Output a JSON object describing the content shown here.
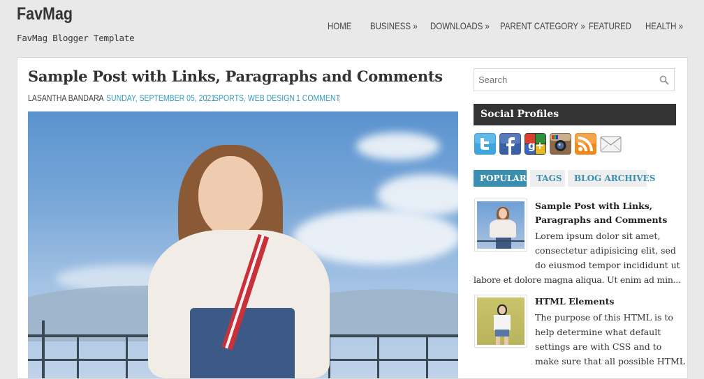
{
  "site": {
    "title": "FavMag",
    "description": "FavMag Blogger Template"
  },
  "nav": [
    {
      "label": "HOME",
      "has_sub": false
    },
    {
      "label": "BUSINESS",
      "has_sub": true
    },
    {
      "label": "DOWNLOADS",
      "has_sub": true
    },
    {
      "label": "PARENT CATEGORY",
      "has_sub": true
    },
    {
      "label": "FEATURED",
      "has_sub": false
    },
    {
      "label": "HEALTH",
      "has_sub": true
    }
  ],
  "nav_arrow": "»",
  "post": {
    "title": "Sample Post with Links, Paragraphs and Comments",
    "author": "LASANTHA BANDARA",
    "date": "SUNDAY, SEPTEMBER 05, 2021",
    "labels": "SPORTS, WEB DESIGN",
    "comments": "1 COMMENT"
  },
  "search": {
    "placeholder": "Search"
  },
  "social_widget": {
    "title": "Social Profiles",
    "icons": [
      "twitter-icon",
      "facebook-icon",
      "google-plus-icon",
      "instagram-icon",
      "rss-icon",
      "email-icon"
    ]
  },
  "tabs": [
    {
      "label": "POPULAR",
      "active": true
    },
    {
      "label": "TAGS",
      "active": false
    },
    {
      "label": "BLOG ARCHIVES",
      "active": false
    }
  ],
  "popular": [
    {
      "title_lines": [
        "Sample Post with Links,",
        "Paragraphs and Comments"
      ],
      "text_lines": [
        "Lorem ipsum dolor sit amet,",
        "consectetur adipisicing elit, sed",
        "do eiusmod tempor incididunt ut",
        "labore et dolore magna aliqua. Ut enim ad min..."
      ]
    },
    {
      "title_lines": [
        "HTML Elements"
      ],
      "text_lines": [
        "The purpose of this HTML is to",
        "help determine what default",
        "settings are with CSS and to",
        "make sure that all possible HTML"
      ]
    }
  ],
  "colors": {
    "accent": "#3a9cc0",
    "tab_active": "#3a8fb0",
    "widget_header": "#333333",
    "background": "#e9e9e9"
  }
}
